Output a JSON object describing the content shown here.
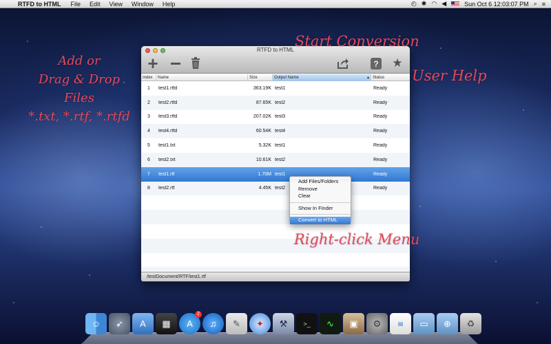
{
  "menubar": {
    "app_name": "RTFD to HTML",
    "items": [
      "File",
      "Edit",
      "View",
      "Window",
      "Help"
    ],
    "clock": "Sun Oct 6  12:03:07 PM"
  },
  "window": {
    "title": "RTFD to HTML",
    "columns": {
      "index": "Index",
      "name": "Name",
      "size": "Size",
      "output": "Output Name",
      "status": "Status"
    },
    "rows": [
      {
        "index": "1",
        "name": "test1.rtfd",
        "size": "363.19K",
        "output": "test1",
        "status": "Ready"
      },
      {
        "index": "2",
        "name": "test2.rtfd",
        "size": "87.65K",
        "output": "test2",
        "status": "Ready"
      },
      {
        "index": "3",
        "name": "test3.rtfd",
        "size": "207.02K",
        "output": "test3",
        "status": "Ready"
      },
      {
        "index": "4",
        "name": "test4.rtfd",
        "size": "60.54K",
        "output": "test4",
        "status": "Ready"
      },
      {
        "index": "5",
        "name": "test1.txt",
        "size": "5.32K",
        "output": "test1",
        "status": "Ready"
      },
      {
        "index": "6",
        "name": "test2.txt",
        "size": "10.61K",
        "output": "test2",
        "status": "Ready"
      },
      {
        "index": "7",
        "name": "test1.rtf",
        "size": "1.70M",
        "output": "test1",
        "status": "Ready"
      },
      {
        "index": "8",
        "name": "test2.rtf",
        "size": "4.45K",
        "output": "test2",
        "status": "Ready"
      }
    ],
    "selected_row": "7",
    "status_path": "/testDocument/RTF/test1.rtf"
  },
  "context_menu": {
    "add": "Add Files/Folders",
    "remove": "Remove",
    "clear": "Clear",
    "show": "Show In Finder",
    "convert": "Convert to HTML"
  },
  "annotations": {
    "add_lines": [
      "Add or",
      "Drag & Drop",
      "Files",
      "*.txt, *.rtf, *.rtfd"
    ],
    "start": "Start Conversion",
    "help": "User Help",
    "right_click": "Right-click Menu"
  },
  "icons": {
    "toolbar": [
      "plus-icon",
      "minus-icon",
      "trash-icon",
      "share-icon",
      "help-icon",
      "star-icon"
    ],
    "dock": [
      "finder-icon",
      "launchpad-icon",
      "app-store-icon",
      "dashboard-icon",
      "app-store-icon",
      "itunes-icon",
      "preview-icon",
      "safari-icon",
      "xcode-icon",
      "terminal-icon",
      "activity-monitor-icon",
      "photo-icon",
      "system-preferences-icon",
      "rtfd-icon",
      "folder-icon",
      "downloads-icon",
      "trash-icon"
    ]
  },
  "dock_badge": "2",
  "colors": {
    "annotation": "#e8485a",
    "selection": "#3578d4"
  }
}
